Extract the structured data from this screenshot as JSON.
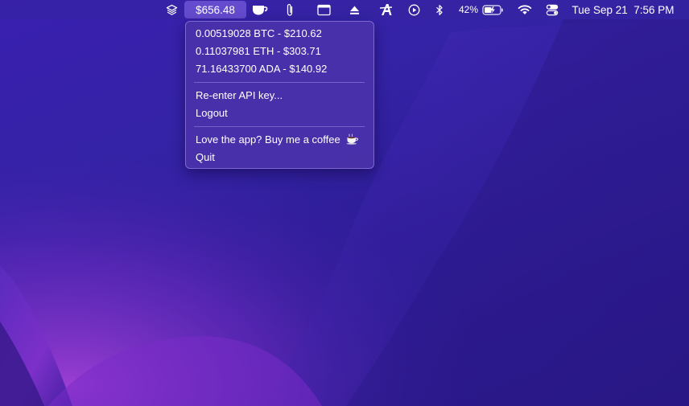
{
  "menubar": {
    "price": "$656.48",
    "battery_percent": "42%",
    "clock": "Tue Sep 21  7:56 PM",
    "icons": [
      "layers-icon",
      "coffee-cup-icon",
      "paperclip-icon",
      "window-icon",
      "eject-icon",
      "sketch-a-icon",
      "play-circle-icon",
      "bluetooth-icon",
      "battery-charging-icon",
      "wifi-icon",
      "control-center-icon"
    ]
  },
  "dropdown": {
    "holdings": [
      {
        "label": "0.00519028 BTC - $210.62"
      },
      {
        "label": "0.11037981 ETH - $303.71"
      },
      {
        "label": "71.16433700 ADA - $140.92"
      }
    ],
    "reenter_api_key": "Re-enter API key...",
    "logout": "Logout",
    "coffee": "Love the app? Buy me a coffee",
    "coffee_icon": "coffee-cup-icon",
    "quit": "Quit"
  },
  "colors": {
    "wallpaper_base": "#2d1c95",
    "wallpaper_highlight": "#7a2cc9",
    "menu_background": "#4a32aa",
    "price_highlight": "#8c6ef0"
  }
}
